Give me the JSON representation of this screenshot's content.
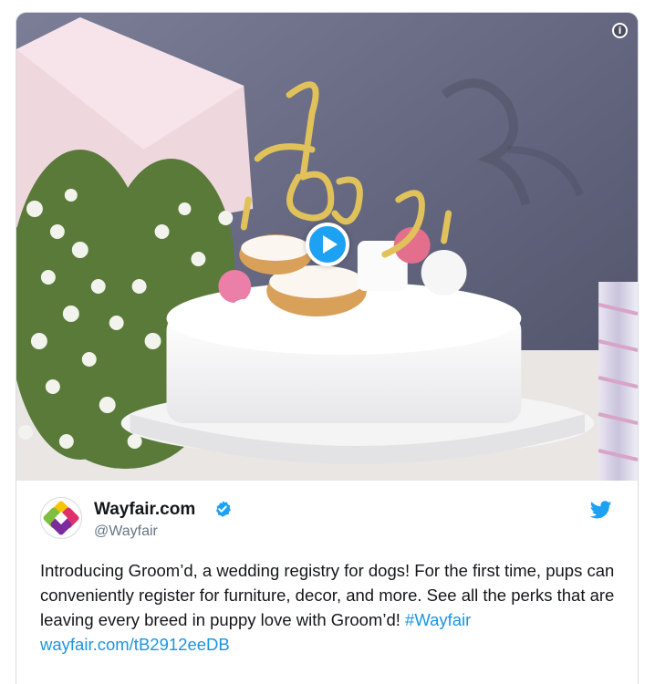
{
  "media": {
    "info_icon": "info-icon",
    "play_icon": "play-icon",
    "cake_topper_text": "I do Love"
  },
  "author": {
    "display_name": "Wayfair.com",
    "handle": "@Wayfair",
    "verified_icon": "verified-badge-icon",
    "avatar_icon": "wayfair-logo-icon"
  },
  "platform_icon": "twitter-bird-icon",
  "tweet": {
    "text": "Introducing Groom’d, a wedding registry for dogs! For the first time, pups can conveniently register for furniture, decor, and more. See all the perks that are leaving every breed in puppy love with Groom’d!",
    "hashtag": "#Wayfair",
    "link": "wayfair.com/tB2912eeDB"
  },
  "colors": {
    "link": "#1b95e0",
    "verified": "#1da1f2",
    "play": "#1da1f2",
    "wall": "#6b6f86",
    "gold": "#e1c25a"
  }
}
